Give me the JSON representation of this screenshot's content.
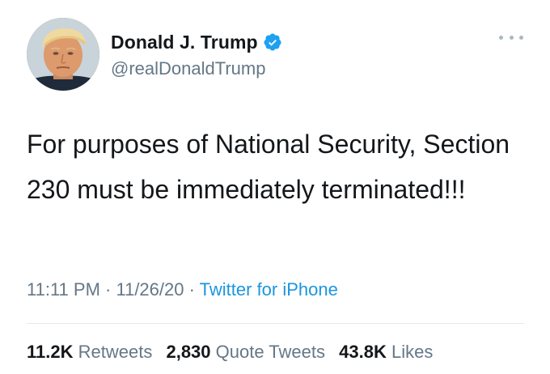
{
  "author": {
    "display_name": "Donald J. Trump",
    "handle": "@realDonaldTrump",
    "verified_icon": "verified-badge-icon",
    "avatar": "profile-photo"
  },
  "tweet": {
    "text": "For purposes of National Security, Section 230 must be immediately terminated!!!",
    "time": "11:11 PM",
    "date": "11/26/20",
    "separator": "·",
    "source": "Twitter for iPhone"
  },
  "stats": {
    "retweets_count": "11.2K",
    "retweets_label": "Retweets",
    "quote_tweets_count": "2,830",
    "quote_tweets_label": "Quote Tweets",
    "likes_count": "43.8K",
    "likes_label": "Likes"
  },
  "colors": {
    "text": "#14171a",
    "secondary": "#657786",
    "link": "#1b95e0",
    "verified": "#1da1f2",
    "divider": "#e1e8ed"
  },
  "icons": {
    "more": "more-options-icon"
  }
}
